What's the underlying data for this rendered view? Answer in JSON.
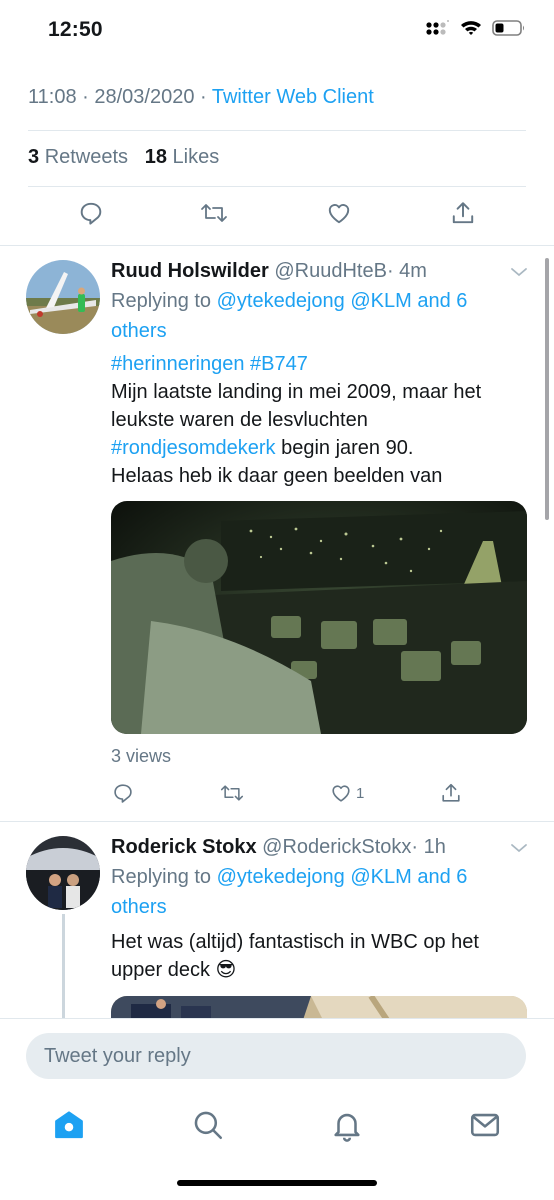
{
  "status_bar": {
    "time": "12:50"
  },
  "tweet_detail": {
    "time": "11:08 · 28/03/2020",
    "separator": " · ",
    "client": "Twitter Web Client",
    "retweets_count": "3",
    "retweets_label": "Retweets",
    "likes_count": "18",
    "likes_label": "Likes"
  },
  "replies": [
    {
      "name": "Ruud Holswilder",
      "handle": "@RuudHteB",
      "time": "· 4m",
      "replying_prefix": "Replying to",
      "replying_links": "@ytekedejong @KLM and 6 others",
      "text_tags_1": "#herinneringen #B747",
      "text_line_2": "Mijn laatste landing in mei 2009, maar het leukste waren de lesvluchten",
      "text_tag_3": "#rondjesomdekerk",
      "text_line_3_rest": " begin jaren 90.",
      "text_line_4": "Helaas heb ik daar geen beelden van",
      "views": "3 views",
      "like_count": "1"
    },
    {
      "name": "Roderick Stokx",
      "handle": "@RoderickStokx",
      "time": "· 1h",
      "replying_prefix": "Replying to",
      "replying_links": "@ytekedejong @KLM and 6 others",
      "text": "Het was (altijd) fantastisch in WBC op het upper deck 😎"
    }
  ],
  "reply_composer": {
    "placeholder": "Tweet your reply"
  },
  "colors": {
    "accent": "#1da1f2",
    "muted": "#657786",
    "text": "#14171a"
  },
  "icons": [
    "reply-icon",
    "retweet-icon",
    "like-icon",
    "share-icon",
    "home-icon",
    "search-icon",
    "notifications-icon",
    "messages-icon"
  ]
}
